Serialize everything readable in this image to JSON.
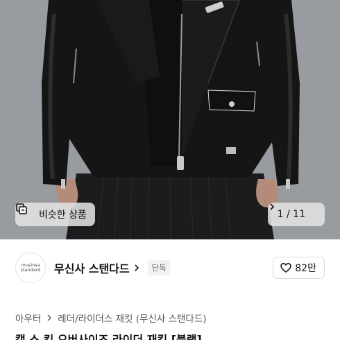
{
  "gallery": {
    "similar_label": "비슷한 상품",
    "pager_text": "1 / 11"
  },
  "brand": {
    "logo_line1": "musinsa",
    "logo_line2": "standard",
    "name": "무신사 스탠다드",
    "exclusive_badge": "단독",
    "likes": "82만"
  },
  "breadcrumb": {
    "items": [
      "아우터",
      "레더/라이더스 재킷 (무신사 스탠다드)"
    ]
  },
  "product": {
    "title": "캡 스 킨 오버사이즈 라이더 재킷 [블랙]"
  },
  "colors": {
    "jacket": "#161616",
    "background": "#9a9ea3"
  }
}
